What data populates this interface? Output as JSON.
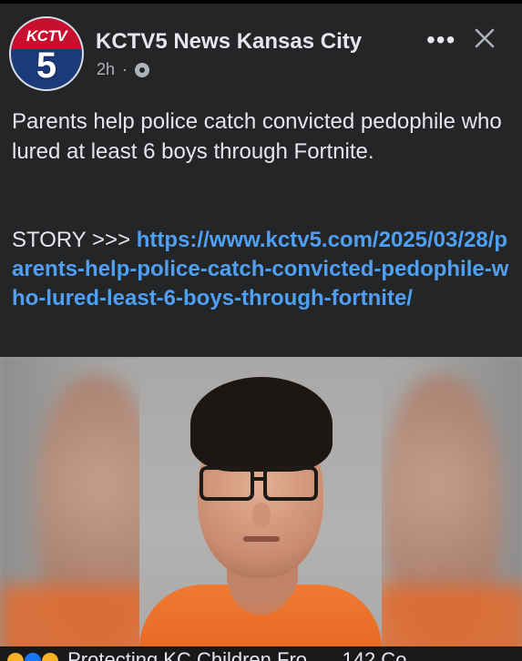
{
  "header": {
    "logo_text": "KCTV",
    "logo_number": "5",
    "page_name": "KCTV5 News Kansas City",
    "time": "2h",
    "separator": "·",
    "more_label": "•••"
  },
  "post": {
    "body": "Parents help police catch convicted pedophile who lured at least 6 boys through Fortnite.",
    "story_prefix": "STORY >>> ",
    "link": "https://www.kctv5.com/2025/03/28/parents-help-police-catch-convicted-pedophile-who-lured-least-6-boys-through-fortnite/"
  },
  "footer": {
    "text": "Protecting KC Children Fro...",
    "count": "142 Co..."
  },
  "colors": {
    "background": "#242526",
    "link": "#4fa0f5",
    "logo_red": "#c8102e",
    "logo_blue": "#1a3a7a",
    "shirt_orange": "#e76722"
  }
}
